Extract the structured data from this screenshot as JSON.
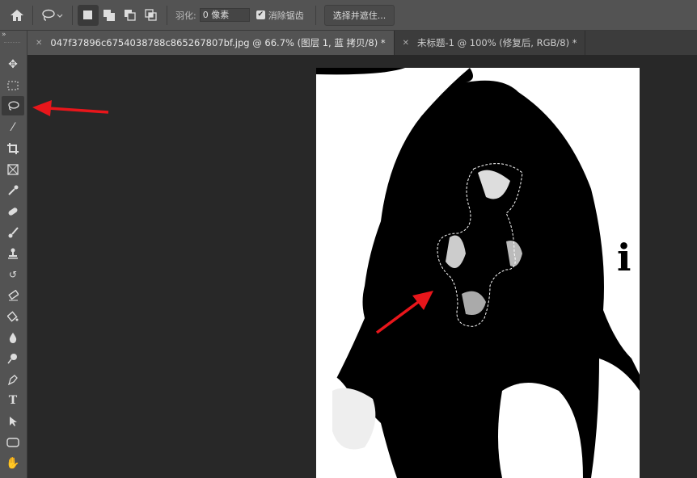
{
  "options": {
    "feather_label": "羽化:",
    "feather_value": "0 像素",
    "antialias_label": "消除锯齿",
    "antialias_checked": true,
    "select_mask_button": "选择并遮住..."
  },
  "tabs": [
    {
      "label": "047f37896c6754038788c865267807bf.jpg @ 66.7% (图层 1, 蓝 拷贝/8) *",
      "active": true
    },
    {
      "label": "未标题-1 @ 100% (修复后, RGB/8) *",
      "active": false
    }
  ],
  "toolbar_collapse": "»",
  "tools": [
    "move",
    "rect-marquee",
    "lasso",
    "magic-wand",
    "crop",
    "frame",
    "eyedropper",
    "healing-brush",
    "brush",
    "clone-stamp",
    "history-brush",
    "eraser",
    "paint-bucket",
    "blur",
    "dodge",
    "pen",
    "type",
    "path-select",
    "rectangle",
    "hand"
  ],
  "active_tool": "lasso",
  "canvas": {
    "letter": "i"
  },
  "annotation_color": "#e8161b"
}
